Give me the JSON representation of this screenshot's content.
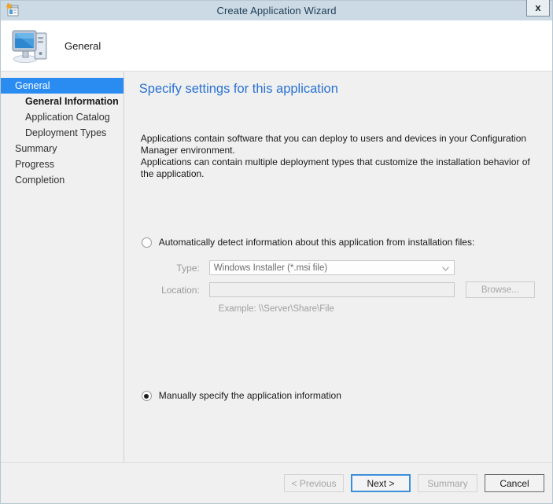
{
  "window": {
    "title": "Create Application Wizard",
    "title_icon": "application-wizard-icon",
    "close_label": "x"
  },
  "header": {
    "icon": "computer-monitor-icon",
    "title": "General"
  },
  "sidebar": {
    "items": [
      {
        "label": "General",
        "level": 0,
        "selected": true,
        "bold": false
      },
      {
        "label": "General Information",
        "level": 1,
        "selected": false,
        "bold": true
      },
      {
        "label": "Application Catalog",
        "level": 1,
        "selected": false,
        "bold": false
      },
      {
        "label": "Deployment Types",
        "level": 1,
        "selected": false,
        "bold": false
      },
      {
        "label": "Summary",
        "level": 0,
        "selected": false,
        "bold": false
      },
      {
        "label": "Progress",
        "level": 0,
        "selected": false,
        "bold": false
      },
      {
        "label": "Completion",
        "level": 0,
        "selected": false,
        "bold": false
      }
    ]
  },
  "content": {
    "heading": "Specify settings for this application",
    "intro_line1": "Applications contain software that you can deploy to users and devices in your Configuration Manager environment.",
    "intro_line2": "Applications can contain multiple deployment types that customize the installation behavior of the application.",
    "option_auto": {
      "label": "Automatically detect information about this application from installation files:",
      "selected": false
    },
    "option_manual": {
      "label": "Manually specify the application information",
      "selected": true
    },
    "type_label": "Type:",
    "type_value": "Windows Installer (*.msi file)",
    "type_chevron": "chevron-down-icon",
    "location_label": "Location:",
    "location_value": "",
    "browse_label": "Browse...",
    "example_text": "Example: \\\\Server\\Share\\File"
  },
  "footer": {
    "buttons": [
      {
        "label": "< Previous",
        "state": "disabled"
      },
      {
        "label": "Next >",
        "state": "default"
      },
      {
        "label": "Summary",
        "state": "disabled"
      },
      {
        "label": "Cancel",
        "state": "strong"
      }
    ]
  },
  "colors": {
    "accent_blue": "#2a8bf0",
    "heading_blue": "#2a72d4",
    "titlebar": "#ccdae5"
  }
}
